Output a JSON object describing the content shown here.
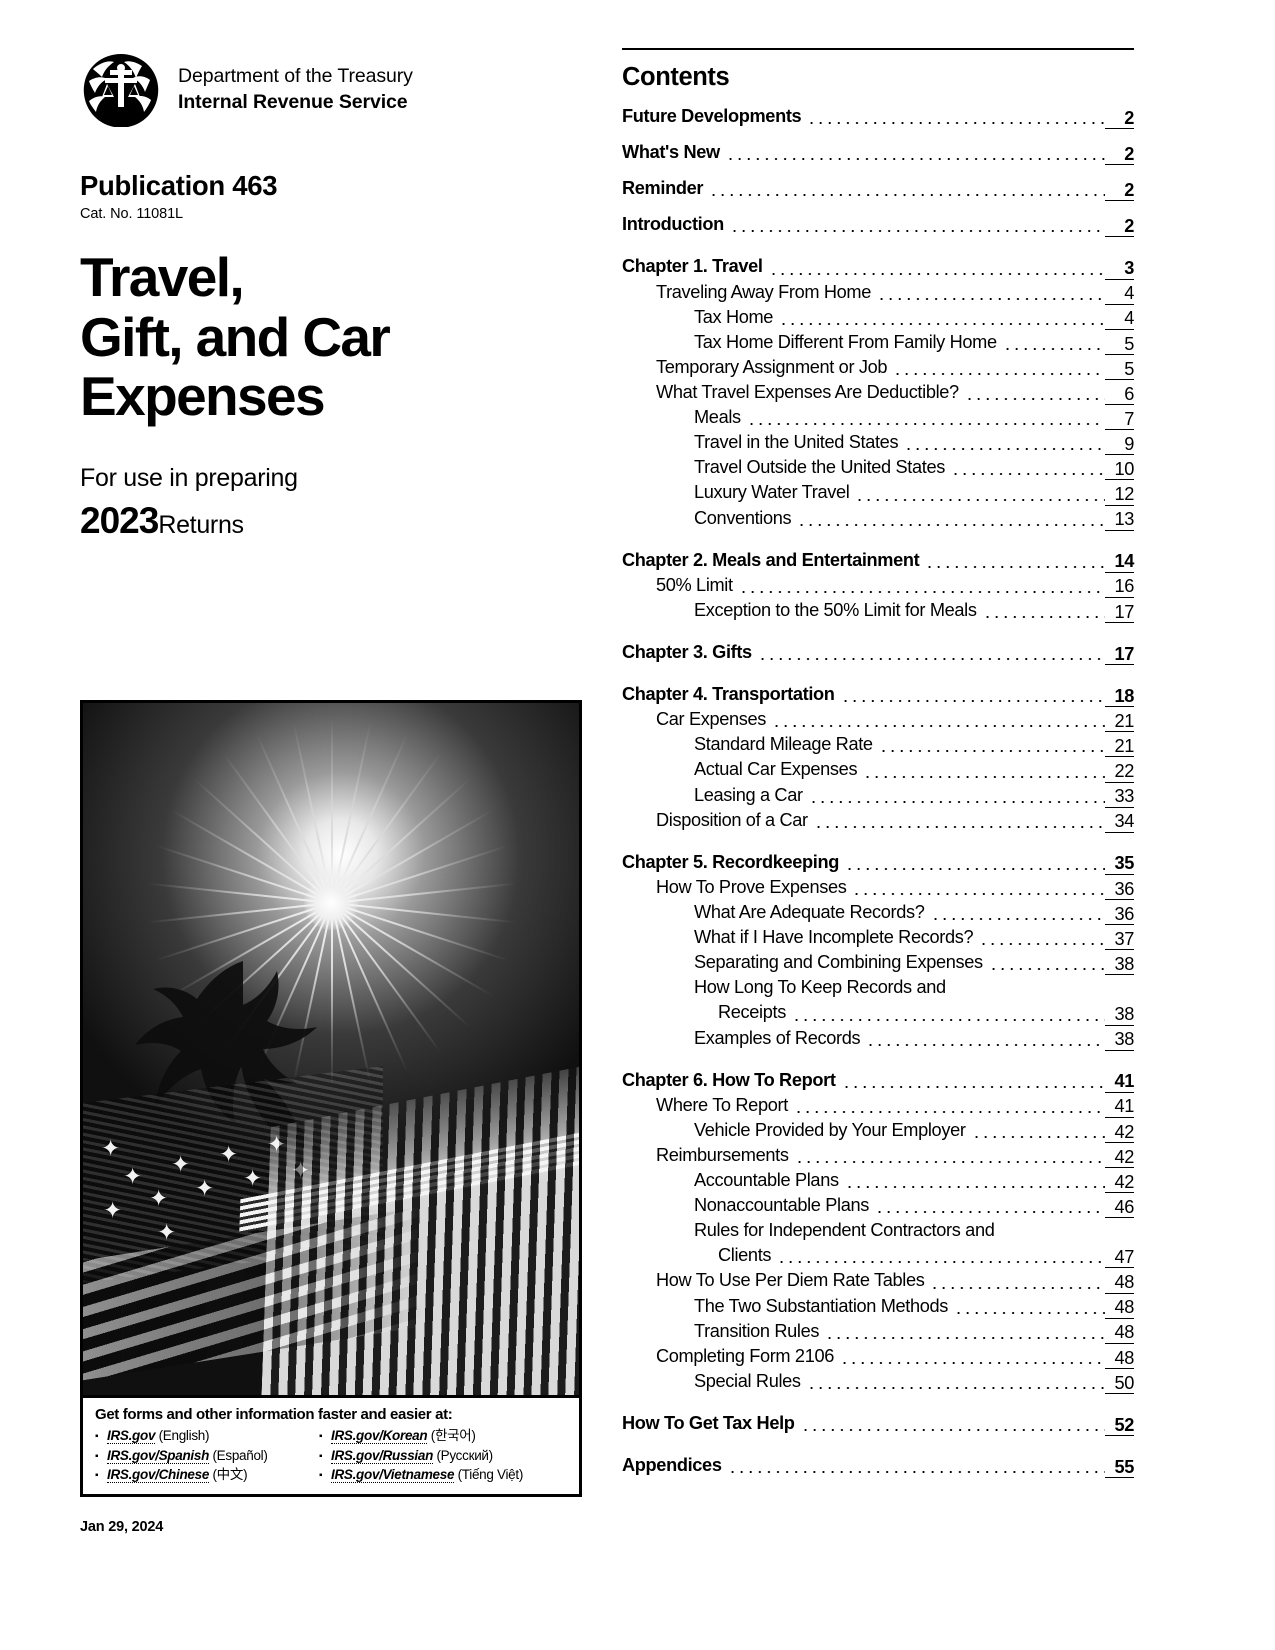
{
  "agency": {
    "seal_icon": "irs-eagle-scales-seal",
    "department": "Department of the Treasury",
    "bureau": "Internal Revenue Service"
  },
  "publication": {
    "number": "Publication 463",
    "catalog": "Cat. No. 11081L",
    "title_line1": "Travel,",
    "title_line2": "Gift, and Car",
    "title_line3": "Expenses",
    "prep_label": "For use in preparing",
    "year": "2023",
    "returns_label": "Returns"
  },
  "cover_caption": {
    "heading": "Get forms and other information faster and easier at:",
    "links_col1": [
      {
        "url": "IRS.gov",
        "lang": "(English)"
      },
      {
        "url": "IRS.gov/Spanish",
        "lang": "(Español)"
      },
      {
        "url": "IRS.gov/Chinese",
        "lang": "(中文)"
      }
    ],
    "links_col2": [
      {
        "url": "IRS.gov/Korean",
        "lang": "(한국어)"
      },
      {
        "url": "IRS.gov/Russian",
        "lang": "(Русский)"
      },
      {
        "url": "IRS.gov/Vietnamese",
        "lang": "(Tiếng Việt)"
      }
    ]
  },
  "footer": {
    "date": "Jan 29, 2024"
  },
  "contents": {
    "heading": "Contents",
    "entries": [
      {
        "level": 0,
        "label": "Future Developments",
        "page": "2"
      },
      {
        "level": 0,
        "label": "What's New",
        "page": "2"
      },
      {
        "level": 0,
        "label": "Reminder",
        "page": "2"
      },
      {
        "level": 0,
        "label": "Introduction",
        "page": "2"
      },
      {
        "level": 0,
        "chapter": true,
        "label": "Chapter 1. Travel",
        "page": "3"
      },
      {
        "level": 1,
        "label": "Traveling Away From Home",
        "page": "4"
      },
      {
        "level": 2,
        "label": "Tax Home",
        "page": "4"
      },
      {
        "level": 2,
        "label": "Tax Home Different From Family Home",
        "page": "5"
      },
      {
        "level": 1,
        "label": "Temporary Assignment or Job",
        "page": "5"
      },
      {
        "level": 1,
        "label": "What Travel Expenses Are Deductible?",
        "page": "6"
      },
      {
        "level": 2,
        "label": "Meals",
        "page": "7"
      },
      {
        "level": 2,
        "label": "Travel in the United States",
        "page": "9"
      },
      {
        "level": 2,
        "label": "Travel Outside the United States",
        "page": "10"
      },
      {
        "level": 2,
        "label": "Luxury Water Travel",
        "page": "12"
      },
      {
        "level": 2,
        "label": "Conventions",
        "page": "13"
      },
      {
        "level": 0,
        "chapter": true,
        "label": "Chapter 2. Meals and Entertainment",
        "page": "14"
      },
      {
        "level": 1,
        "label": "50% Limit",
        "page": "16"
      },
      {
        "level": 2,
        "label": "Exception to the 50% Limit for Meals",
        "page": "17"
      },
      {
        "level": 0,
        "chapter": true,
        "label": "Chapter 3. Gifts",
        "page": "17"
      },
      {
        "level": 0,
        "chapter": true,
        "label": "Chapter 4. Transportation",
        "page": "18"
      },
      {
        "level": 1,
        "label": "Car Expenses",
        "page": "21"
      },
      {
        "level": 2,
        "label": "Standard Mileage Rate",
        "page": "21"
      },
      {
        "level": 2,
        "label": "Actual Car Expenses",
        "page": "22"
      },
      {
        "level": 2,
        "label": "Leasing a Car",
        "page": "33"
      },
      {
        "level": 1,
        "label": "Disposition of a Car",
        "page": "34"
      },
      {
        "level": 0,
        "chapter": true,
        "label": "Chapter 5. Recordkeeping",
        "page": "35"
      },
      {
        "level": 1,
        "label": "How To Prove Expenses",
        "page": "36"
      },
      {
        "level": 2,
        "label": "What Are Adequate Records?",
        "page": "36"
      },
      {
        "level": 2,
        "label": "What if I Have Incomplete Records?",
        "page": "37"
      },
      {
        "level": 2,
        "label": "Separating and Combining Expenses",
        "page": "38"
      },
      {
        "level": 2,
        "wrap": true,
        "label": "How Long To Keep Records and",
        "label2": "Receipts",
        "page": "38"
      },
      {
        "level": 2,
        "label": "Examples of Records",
        "page": "38"
      },
      {
        "level": 0,
        "chapter": true,
        "label": "Chapter 6. How To Report",
        "page": "41"
      },
      {
        "level": 1,
        "label": "Where To Report",
        "page": "41"
      },
      {
        "level": 2,
        "label": "Vehicle Provided by Your Employer",
        "page": "42"
      },
      {
        "level": 1,
        "label": "Reimbursements",
        "page": "42"
      },
      {
        "level": 2,
        "label": "Accountable Plans",
        "page": "42"
      },
      {
        "level": 2,
        "label": "Nonaccountable Plans",
        "page": "46"
      },
      {
        "level": 2,
        "wrap": true,
        "label": "Rules for Independent Contractors and",
        "label2": "Clients",
        "page": "47"
      },
      {
        "level": 1,
        "label": "How To Use Per Diem Rate Tables",
        "page": "48"
      },
      {
        "level": 2,
        "label": "The Two Substantiation Methods",
        "page": "48"
      },
      {
        "level": 2,
        "label": "Transition Rules",
        "page": "48"
      },
      {
        "level": 1,
        "label": "Completing Form 2106",
        "page": "48"
      },
      {
        "level": 2,
        "label": "Special Rules",
        "page": "50"
      },
      {
        "level": 0,
        "chapter": true,
        "label": "How To Get Tax Help",
        "page": "52"
      },
      {
        "level": 0,
        "chapter": true,
        "label": "Appendices",
        "page": "55"
      }
    ]
  },
  "colors": {
    "ink": "#000000",
    "paper": "#ffffff"
  }
}
